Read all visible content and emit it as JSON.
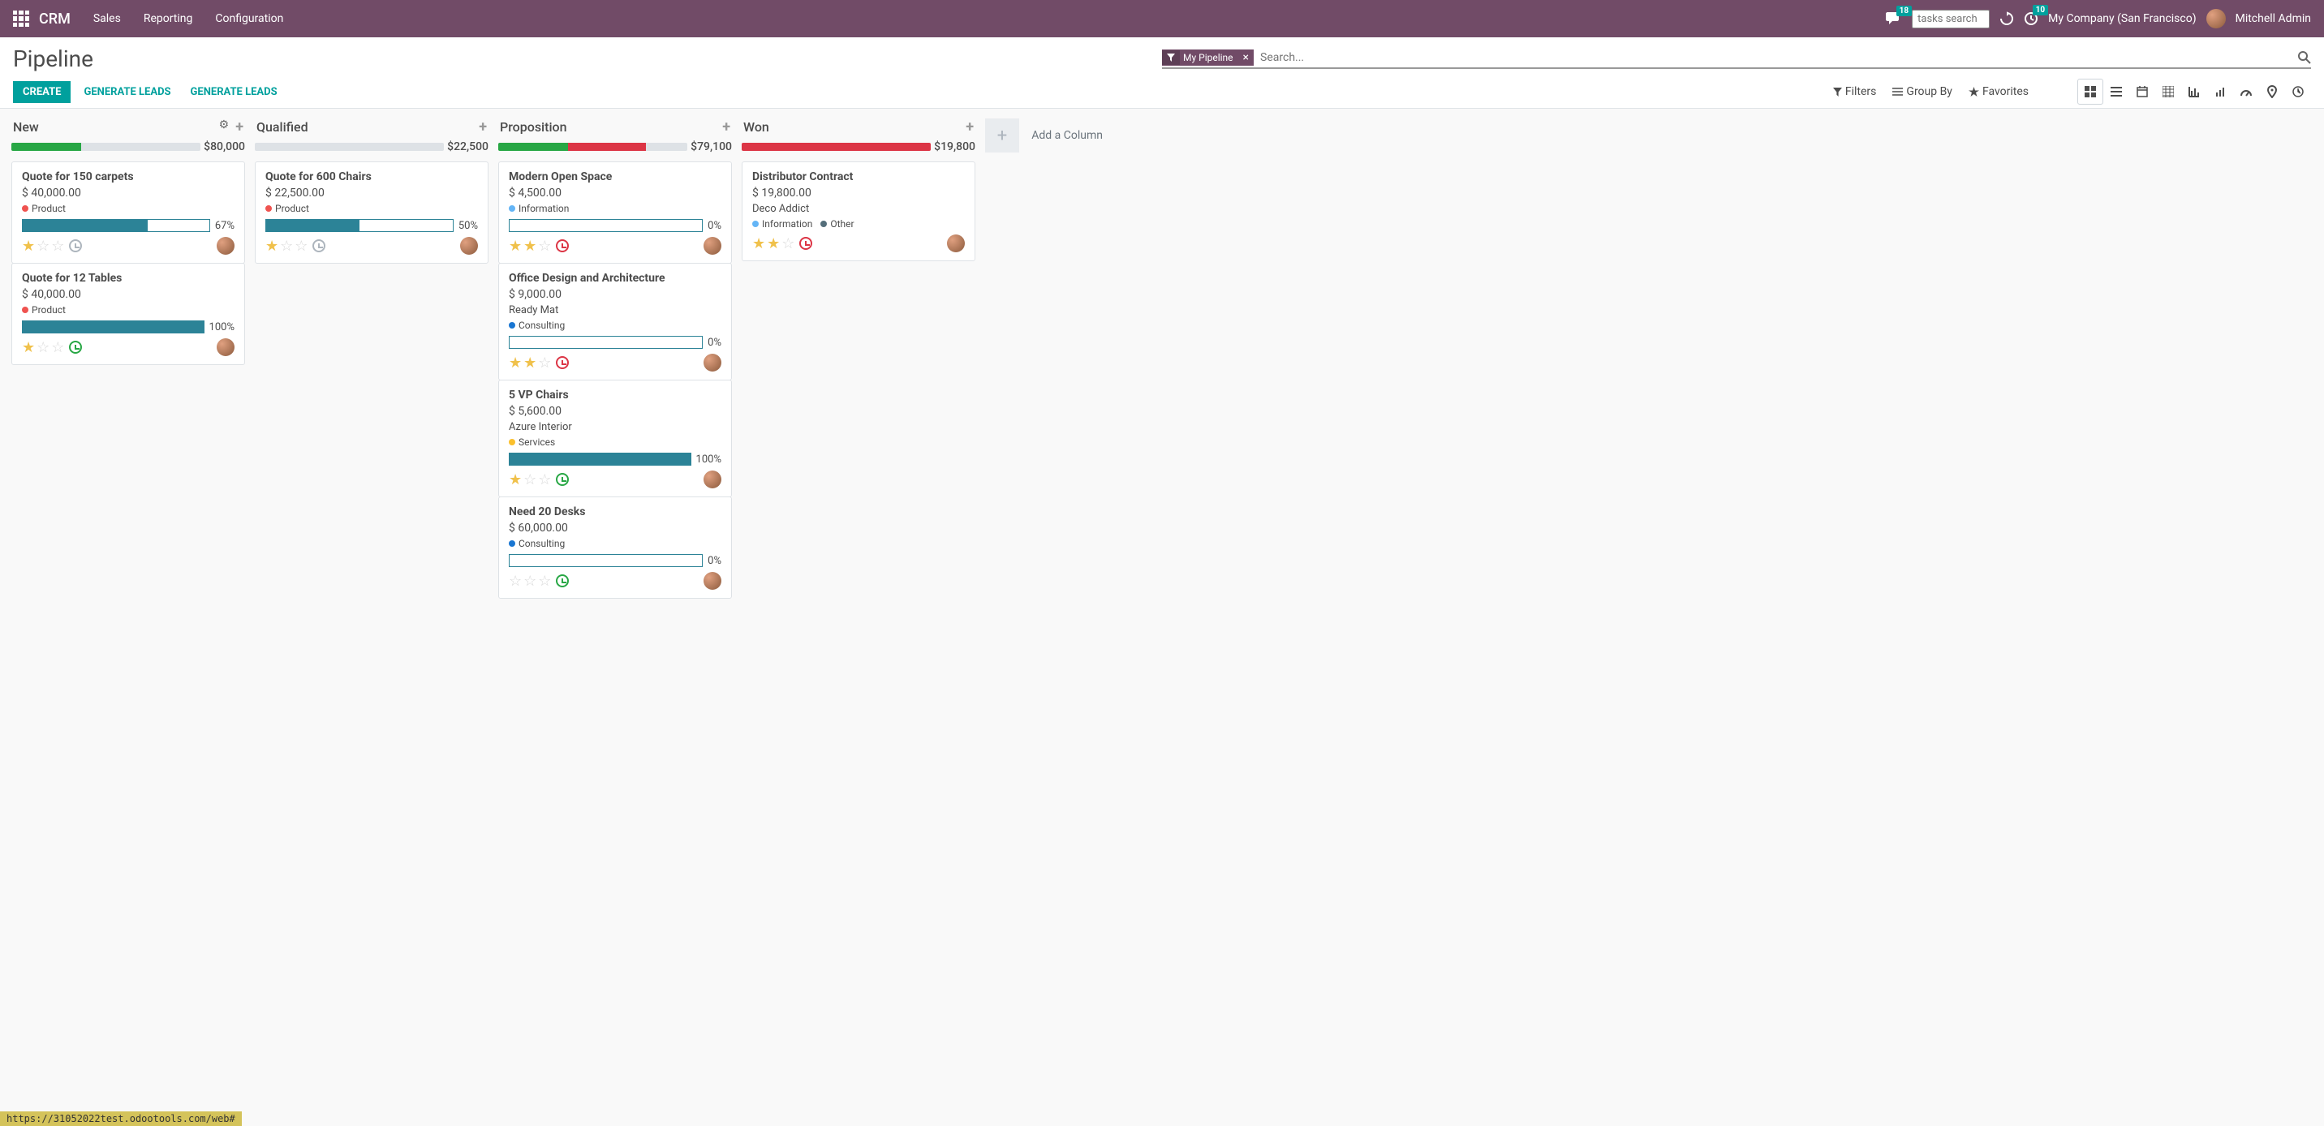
{
  "navbar": {
    "brand": "CRM",
    "menu": [
      "Sales",
      "Reporting",
      "Configuration"
    ],
    "messages_badge": "18",
    "activities_badge": "10",
    "tasks_placeholder": "tasks search",
    "company": "My Company (San Francisco)",
    "user": "Mitchell Admin"
  },
  "control_panel": {
    "breadcrumb": "Pipeline",
    "facet_label": "My Pipeline",
    "search_placeholder": "Search...",
    "create_btn": "CREATE",
    "gen_leads_1": "GENERATE LEADS",
    "gen_leads_2": "GENERATE LEADS",
    "filters": "Filters",
    "group_by": "Group By",
    "favorites": "Favorites"
  },
  "add_column": "Add a Column",
  "columns": [
    {
      "title": "New",
      "total": "$80,000",
      "show_gear": true,
      "progress": [
        {
          "color": "#28a745",
          "width": 37
        }
      ],
      "cards": [
        {
          "title": "Quote for 150 carpets",
          "amount": "$ 40,000.00",
          "customer": null,
          "tags": [
            {
              "color": "#ef5350",
              "label": "Product"
            }
          ],
          "gauge": 67,
          "gauge_label": "67%",
          "stars": 1,
          "activity": "planned"
        },
        {
          "title": "Quote for 12 Tables",
          "amount": "$ 40,000.00",
          "customer": null,
          "tags": [
            {
              "color": "#ef5350",
              "label": "Product"
            }
          ],
          "gauge": 100,
          "gauge_label": "100%",
          "stars": 1,
          "activity": "today"
        }
      ]
    },
    {
      "title": "Qualified",
      "total": "$22,500",
      "show_gear": false,
      "progress": [],
      "cards": [
        {
          "title": "Quote for 600 Chairs",
          "amount": "$ 22,500.00",
          "customer": null,
          "tags": [
            {
              "color": "#ef5350",
              "label": "Product"
            }
          ],
          "gauge": 50,
          "gauge_label": "50%",
          "stars": 1,
          "activity": "planned"
        }
      ]
    },
    {
      "title": "Proposition",
      "total": "$79,100",
      "show_gear": false,
      "progress": [
        {
          "color": "#28a745",
          "width": 37
        },
        {
          "color": "#dc3545",
          "width": 41
        }
      ],
      "cards": [
        {
          "title": "Modern Open Space",
          "amount": "$ 4,500.00",
          "customer": null,
          "tags": [
            {
              "color": "#64b5f6",
              "label": "Information"
            }
          ],
          "gauge": 0,
          "gauge_label": "0%",
          "stars": 2,
          "activity": "overdue"
        },
        {
          "title": "Office Design and Architecture",
          "amount": "$ 9,000.00",
          "customer": "Ready Mat",
          "tags": [
            {
              "color": "#1976d2",
              "label": "Consulting"
            }
          ],
          "gauge": 0,
          "gauge_label": "0%",
          "stars": 2,
          "activity": "overdue"
        },
        {
          "title": "5 VP Chairs",
          "amount": "$ 5,600.00",
          "customer": "Azure Interior",
          "tags": [
            {
              "color": "#fbc02d",
              "label": "Services"
            }
          ],
          "gauge": 100,
          "gauge_label": "100%",
          "stars": 1,
          "activity": "today"
        },
        {
          "title": "Need 20 Desks",
          "amount": "$ 60,000.00",
          "customer": null,
          "tags": [
            {
              "color": "#1976d2",
              "label": "Consulting"
            }
          ],
          "gauge": 0,
          "gauge_label": "0%",
          "stars": 0,
          "activity": "today"
        }
      ]
    },
    {
      "title": "Won",
      "total": "$19,800",
      "show_gear": false,
      "progress": [
        {
          "color": "#dc3545",
          "width": 100
        }
      ],
      "cards": [
        {
          "title": "Distributor Contract",
          "amount": "$ 19,800.00",
          "customer": "Deco Addict",
          "tags": [
            {
              "color": "#64b5f6",
              "label": "Information"
            },
            {
              "color": "#546e7a",
              "label": "Other"
            }
          ],
          "gauge": null,
          "gauge_label": null,
          "stars": 2,
          "activity": "overdue"
        }
      ]
    }
  ],
  "status_bar": "https://31052022test.odootools.com/web#"
}
